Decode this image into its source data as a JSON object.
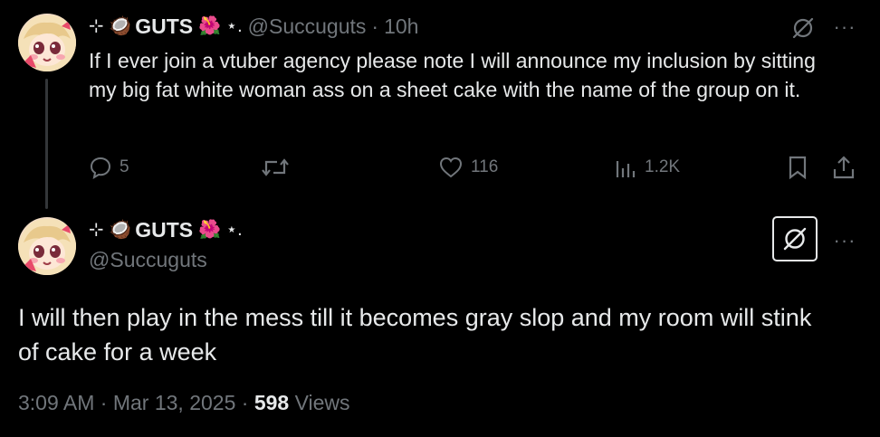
{
  "reply_parent": {
    "display_name": "GUTS",
    "name_prefix": "⊹ 🥥",
    "name_suffix": "🌺 ⋆.",
    "handle": "@Succuguts",
    "separator": "·",
    "time_ago": "10h",
    "text": "If I ever join a vtuber agency please note I will announce my inclusion by sitting my big fat white woman ass on a sheet cake with the name of the group on it.",
    "actions": {
      "replies": "5",
      "retweets": "",
      "likes": "116",
      "views": "1.2K"
    },
    "more": "···"
  },
  "main_tweet": {
    "display_name": "GUTS",
    "name_prefix": "⊹ 🥥",
    "name_suffix": "🌺 ⋆.",
    "handle": "@Succuguts",
    "text": "I will then play in the mess till it becomes gray slop and my room will stink of cake for a week",
    "more": "···",
    "meta": {
      "time": "3:09 AM",
      "date": "Mar 13, 2025",
      "separator": "·",
      "views_count": "598",
      "views_label": "Views"
    }
  },
  "colors": {
    "background": "#000000",
    "text_primary": "#e7e9ea",
    "text_secondary": "#71767b",
    "thread_line": "#333639"
  },
  "icons": [
    "avatar",
    "grok-icon",
    "reply-icon",
    "retweet-icon",
    "like-icon",
    "views-icon",
    "bookmark-icon",
    "share-icon",
    "more-icon"
  ]
}
